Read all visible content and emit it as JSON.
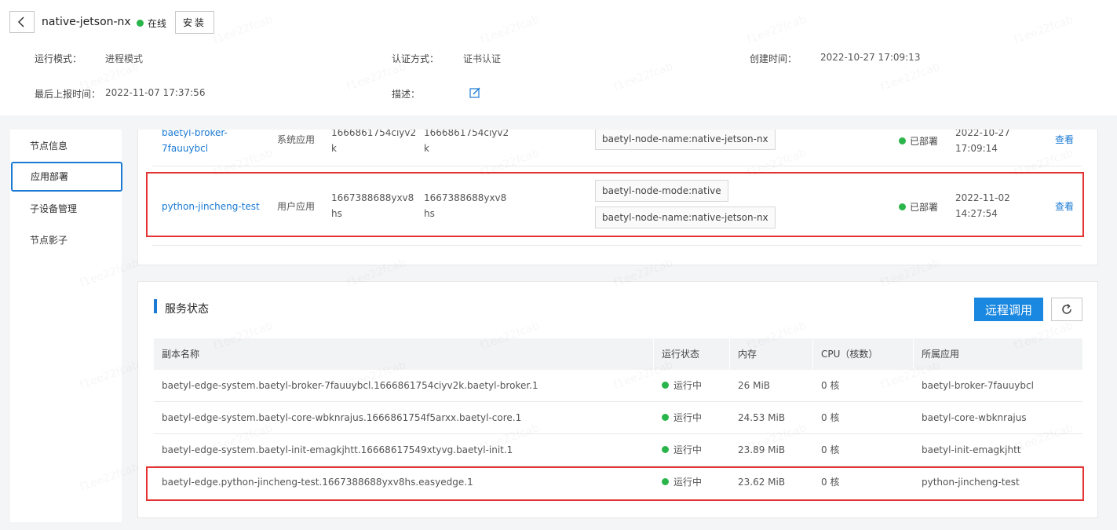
{
  "header": {
    "node_name": "native-jetson-nx",
    "online_label": "在线",
    "install_label": "安装",
    "info": {
      "run_mode_label": "运行模式：",
      "run_mode_value": "进程模式",
      "auth_label": "认证方式：",
      "auth_value": "证书认证",
      "created_label": "创建时间：",
      "created_value": "2022-10-27 17:09:13",
      "last_report_label": "最后上报时间：",
      "last_report_value": "2022-11-07 17:37:56",
      "desc_label": "描述："
    }
  },
  "sidebar": {
    "items": [
      {
        "label": "节点信息"
      },
      {
        "label": "应用部署"
      },
      {
        "label": "子设备管理"
      },
      {
        "label": "节点影子"
      }
    ]
  },
  "apps": {
    "rows": [
      {
        "name_line1": "baetyl-broker-",
        "name_line2": "7fauuybcl",
        "type": "系统应用",
        "version_line1": "1666861754ciyv2",
        "version_line2": "k",
        "config_line1": "1666861754ciyv2",
        "config_line2": "k",
        "tags": [
          "baetyl-node-name:native-jetson-nx"
        ],
        "status": "已部署",
        "time_line1": "2022-10-27",
        "time_line2": "17:09:14",
        "action": "查看"
      },
      {
        "name": "python-jincheng-test",
        "type": "用户应用",
        "version_line1": "1667388688yxv8",
        "version_line2": "hs",
        "config_line1": "1667388688yxv8",
        "config_line2": "hs",
        "tags": [
          "baetyl-node-mode:native",
          "baetyl-node-name:native-jetson-nx"
        ],
        "status": "已部署",
        "time_line1": "2022-11-02",
        "time_line2": "14:27:54",
        "action": "查看"
      }
    ]
  },
  "services": {
    "title": "服务状态",
    "remote_label": "远程调用",
    "columns": [
      "副本名称",
      "运行状态",
      "内存",
      "CPU（核数）",
      "所属应用"
    ],
    "rows": [
      {
        "name": "baetyl-edge-system.baetyl-broker-7fauuybcl.1666861754ciyv2k.baetyl-broker.1",
        "status": "运行中",
        "memory": "26 MiB",
        "cpu": "0 核",
        "app": "baetyl-broker-7fauuybcl"
      },
      {
        "name": "baetyl-edge-system.baetyl-core-wbknrajus.1666861754f5arxx.baetyl-core.1",
        "status": "运行中",
        "memory": "24.53 MiB",
        "cpu": "0 核",
        "app": "baetyl-core-wbknrajus"
      },
      {
        "name": "baetyl-edge-system.baetyl-init-emagkjhtt.16668617549xtyvg.baetyl-init.1",
        "status": "运行中",
        "memory": "23.89 MiB",
        "cpu": "0 核",
        "app": "baetyl-init-emagkjhtt"
      },
      {
        "name": "baetyl-edge.python-jincheng-test.1667388688yxv8hs.easyedge.1",
        "status": "运行中",
        "memory": "23.62 MiB",
        "cpu": "0 核",
        "app": "python-jincheng-test"
      }
    ]
  },
  "watermark_text": "f1ee22fcab",
  "colors": {
    "accent": "#1a7ad4",
    "primary_button": "#1a88e0",
    "status_ok": "#2ab54a",
    "highlight": "#e53333"
  },
  "icons": {
    "back": "chevron-left-icon",
    "edit": "edit-icon",
    "refresh": "refresh-icon"
  }
}
